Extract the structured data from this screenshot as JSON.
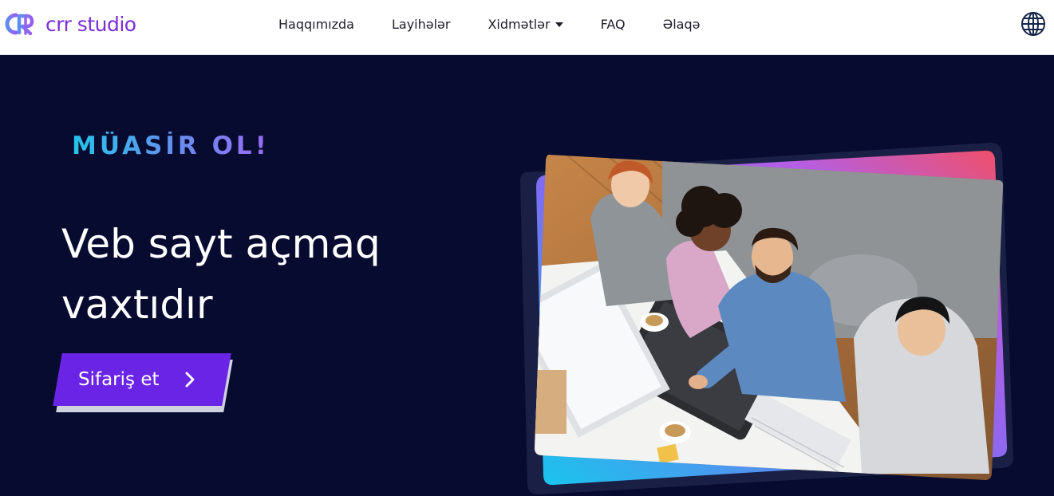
{
  "brand": {
    "name": "crr studio",
    "color": "#7a2fd6"
  },
  "nav": {
    "items": [
      {
        "label": "Haqqımızda",
        "dropdown": false
      },
      {
        "label": "Layihələr",
        "dropdown": false
      },
      {
        "label": "Xidmətlər",
        "dropdown": true
      },
      {
        "label": "FAQ",
        "dropdown": false
      },
      {
        "label": "Əlaqə",
        "dropdown": false
      }
    ],
    "language_icon": "globe-icon"
  },
  "hero": {
    "eyebrow": "MÜASİR OL!",
    "headline": "Veb sayt açmaq vaxtıdır",
    "cta_label": "Sifariş et",
    "cta_icon": "chevron-right-icon",
    "image_icon": "team-photo"
  },
  "colors": {
    "background": "#070b30",
    "accent": "#6a24e6",
    "gradient_start": "#23c4e9",
    "gradient_end": "#f0506e"
  }
}
